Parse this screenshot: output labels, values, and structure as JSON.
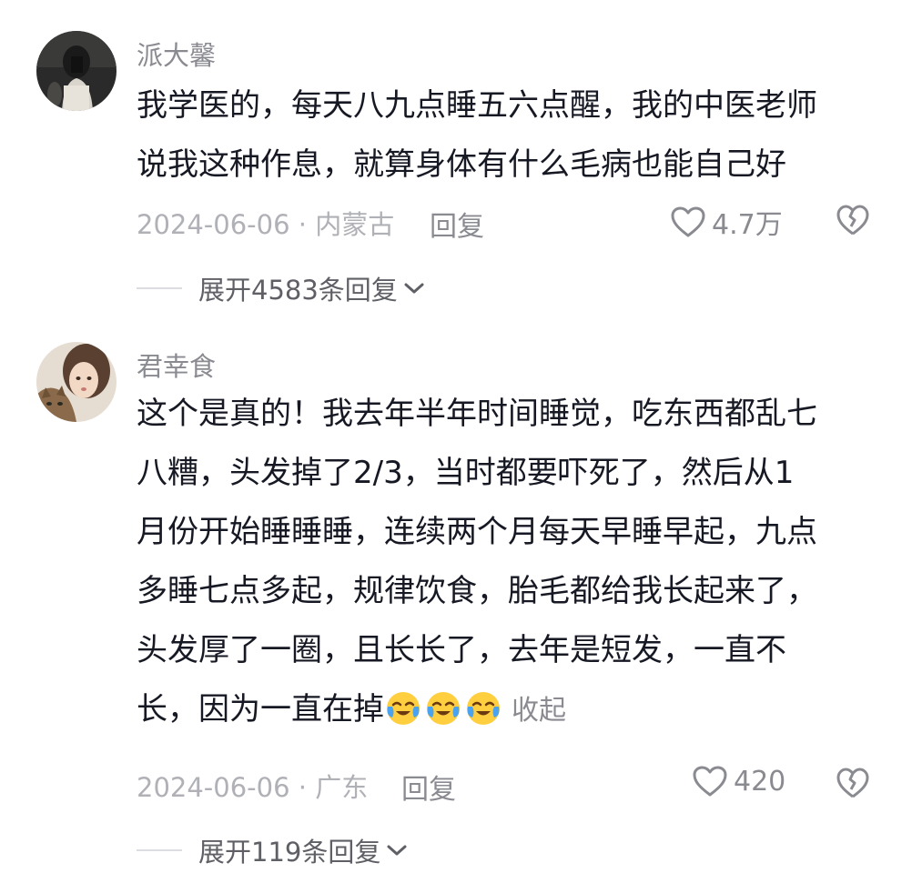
{
  "comments": [
    {
      "username": "派大馨",
      "lines": [
        "我学医的，每天八九点睡五六点醒，我的中医老师",
        "说我这种作息，就算身体有什么毛病也能自己好"
      ],
      "meta": "2024-06-06 · 内蒙古",
      "reply_label": "回复",
      "like_count": "4.7万",
      "expand_label": "展开4583条回复"
    },
    {
      "username": "君幸食",
      "lines": [
        "这个是真的！我去年半年时间睡觉，吃东西都乱七",
        "八糟，头发掉了2/3，当时都要吓死了，然后从1",
        "月份开始睡睡睡，连续两个月每天早睡早起，九点",
        "多睡七点多起，规律饮食，胎毛都给我长起来了，",
        "头发厚了一圈，且长长了，去年是短发，一直不",
        "长，因为一直在掉"
      ],
      "emojis": [
        "crying-laughing-emoji",
        "crying-laughing-emoji",
        "crying-laughing-emoji"
      ],
      "collapse_label": "收起",
      "meta": "2024-06-06 · 广东",
      "reply_label": "回复",
      "like_count": "420",
      "expand_label": "展开119条回复"
    }
  ],
  "colors": {
    "text": "#161823",
    "secondary": "#8a8b91",
    "muted": "#b0b1b6",
    "emoji_face": "#ffcf3f",
    "emoji_tear": "#4aa3f0"
  },
  "icons": [
    "heart-outline-icon",
    "broken-heart-icon",
    "chevron-down-icon"
  ]
}
